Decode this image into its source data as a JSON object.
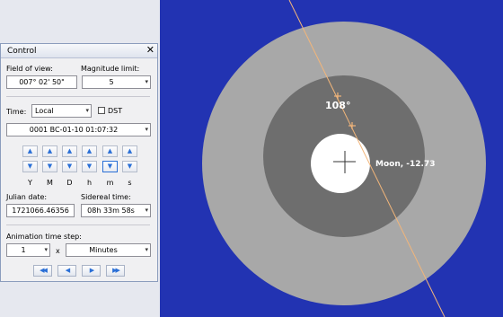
{
  "panel": {
    "title": "Control",
    "close_glyph": "✕",
    "fov_label": "Field of view:",
    "fov_value": "007° 02' 50\"",
    "maglimit_label": "Magnitude limit:",
    "maglimit_value": "5",
    "time_label": "Time:",
    "time_zone": "Local",
    "dst_label": "DST",
    "datetime": "0001 BC-01-10 01:07:32",
    "unit_labels": [
      "Y",
      "M",
      "D",
      "h",
      "m",
      "s"
    ],
    "up_glyph": "▲",
    "down_glyph": "▼",
    "julian_label": "Julian date:",
    "julian_value": "1721066.46356",
    "sidereal_label": "Sidereal time:",
    "sidereal_value": "08h 33m 58s",
    "anim_label": "Animation time step:",
    "anim_multiplier": "1",
    "anim_x": "x",
    "anim_unit": "Minutes",
    "rewind_glyph": "◀◀",
    "back_glyph": "◀",
    "forward_glyph": "▶",
    "fastforward_glyph": "▶▶",
    "dropdown_glyph": "▾"
  },
  "sky": {
    "angle_label": "108°",
    "object_label": "Moon, -12.73"
  },
  "colors": {
    "sky_background": "#2233b2",
    "outer_halo": "#a8a8a8",
    "inner_halo": "#6e6e6e",
    "moon_disk": "#ffffff",
    "ecliptic_line": "#f1b57a"
  }
}
